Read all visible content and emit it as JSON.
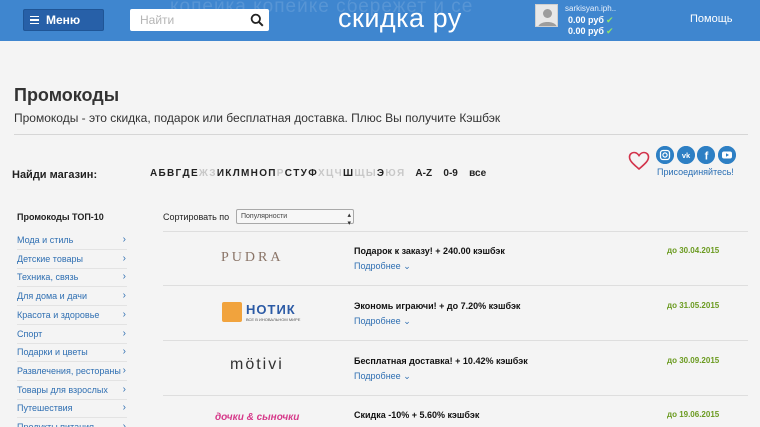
{
  "header": {
    "ghost_text": "копейка копейке сбережет и се",
    "menu_label": "Меню",
    "search_placeholder": "Найти",
    "logo": "скидка ру",
    "user_name": "sarkisyan.iph..",
    "balance_1": "0.00 руб",
    "balance_2": "0.00 руб",
    "help_label": "Помощь"
  },
  "page": {
    "title": "Промокоды",
    "description": "Промокоды - это скидка, подарок или бесплатная доставка. Плюс Вы получите Кэшбэк"
  },
  "finder": {
    "label": "Найди магазин:",
    "letters": [
      {
        "l": "А",
        "on": true
      },
      {
        "l": "Б",
        "on": true
      },
      {
        "l": "В",
        "on": true
      },
      {
        "l": "Г",
        "on": true
      },
      {
        "l": "Д",
        "on": true
      },
      {
        "l": "Е",
        "on": true
      },
      {
        "l": "Ж",
        "on": false
      },
      {
        "l": "З",
        "on": false
      },
      {
        "l": "И",
        "on": true
      },
      {
        "l": "К",
        "on": true
      },
      {
        "l": "Л",
        "on": true
      },
      {
        "l": "М",
        "on": true
      },
      {
        "l": "Н",
        "on": true
      },
      {
        "l": "О",
        "on": true
      },
      {
        "l": "П",
        "on": true
      },
      {
        "l": "Р",
        "on": false
      },
      {
        "l": "С",
        "on": true
      },
      {
        "l": "Т",
        "on": true
      },
      {
        "l": "У",
        "on": true
      },
      {
        "l": "Ф",
        "on": true
      },
      {
        "l": "Х",
        "on": false
      },
      {
        "l": "Ц",
        "on": false
      },
      {
        "l": "Ч",
        "on": false
      },
      {
        "l": "Ш",
        "on": true
      },
      {
        "l": "Щ",
        "on": false
      },
      {
        "l": "Ы",
        "on": false
      },
      {
        "l": "Э",
        "on": true
      },
      {
        "l": "Ю",
        "on": false
      },
      {
        "l": "Я",
        "on": false
      }
    ],
    "group_az": "A-Z",
    "group_09": "0-9",
    "group_all": "все"
  },
  "social": {
    "join_label": "Присоединяйтесь!",
    "icons": [
      "instagram-icon",
      "vk-icon",
      "facebook-icon",
      "youtube-icon"
    ],
    "heart_color": "#d2334b"
  },
  "sidebar": {
    "heading": "Промокоды ТОП-10",
    "items": [
      "Мода и стиль",
      "Детские товары",
      "Техника, связь",
      "Для дома и дачи",
      "Красота и здоровье",
      "Спорт",
      "Подарки и цветы",
      "Развлечения, рестораны",
      "Товары для взрослых",
      "Путешествия",
      "Продукты питания"
    ]
  },
  "sort": {
    "label": "Сортировать по",
    "selected": "Популярности"
  },
  "offers": [
    {
      "brand": "PUDRA",
      "title": "Подарок к заказу! + 240.00 кэшбэк",
      "more": "Подробнее",
      "date": "до 30.04.2015"
    },
    {
      "brand": "НОТИК",
      "brand_sub": "ВСЕ В ИНОВАЛЬНОМ МИРЕ",
      "title": "Экономь играючи! + до 7.20% кэшбэк",
      "more": "Подробнее",
      "date": "до 31.05.2015"
    },
    {
      "brand": "mötivi",
      "title": "Бесплатная доставка! + 10.42% кэшбэк",
      "more": "Подробнее",
      "date": "до 30.09.2015"
    },
    {
      "brand": "дочки & сыночки",
      "title": "Скидка -10% + 5.60% кэшбэк",
      "more": "",
      "date": "до 19.06.2015"
    }
  ]
}
